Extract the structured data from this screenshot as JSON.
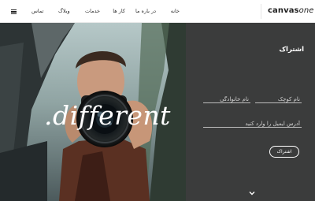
{
  "header": {
    "logo_bold": "canvas",
    "logo_light": "one",
    "menu_icon": "hamburger-icon",
    "nav": [
      {
        "label": "خانه"
      },
      {
        "label": "در باره ما"
      },
      {
        "label": "کار ها"
      },
      {
        "label": "خدمات"
      },
      {
        "label": "وبلاگ"
      },
      {
        "label": "تماس"
      }
    ]
  },
  "hero": {
    "overlay_text": ".different"
  },
  "subscribe": {
    "title": "اشتراک",
    "first_name": {
      "value": "",
      "placeholder": "نام کوچک"
    },
    "last_name": {
      "value": "",
      "placeholder": "نام خانوادگی"
    },
    "email": {
      "value": "",
      "placeholder": "آدرس ایمیل را وارد کنید"
    },
    "submit_label": "اشتراک",
    "scroll_icon": "chevron-down-icon"
  },
  "colors": {
    "panel_bg": "#3b3c3c",
    "nav_bg": "#ffffff",
    "text_dark": "#333333",
    "text_light": "#ffffff"
  }
}
